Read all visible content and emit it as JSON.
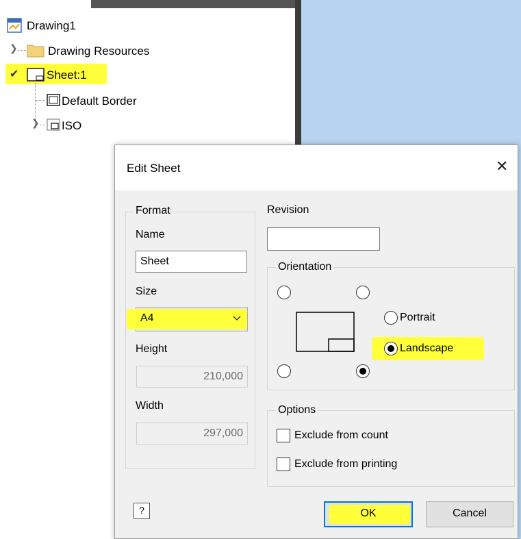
{
  "tree": {
    "root_label": "Drawing1",
    "resources_label": "Drawing Resources",
    "sheet_label": "Sheet:1",
    "border_label": "Default Border",
    "iso_label": "ISO"
  },
  "dialog": {
    "title": "Edit Sheet",
    "close_glyph": "✕",
    "format": {
      "caption": "Format",
      "name_label": "Name",
      "name_value": "Sheet",
      "size_label": "Size",
      "size_value": "A4",
      "height_label": "Height",
      "height_value": "210,000",
      "width_label": "Width",
      "width_value": "297,000"
    },
    "revision": {
      "label": "Revision",
      "value": ""
    },
    "orientation": {
      "caption": "Orientation",
      "portrait_label": "Portrait",
      "landscape_label": "Landscape",
      "selected": "Landscape",
      "title_block_corner": "bottom-right"
    },
    "options": {
      "caption": "Options",
      "exclude_count_label": "Exclude from count",
      "exclude_printing_label": "Exclude from printing"
    },
    "buttons": {
      "help_glyph": "?",
      "ok_label": "OK",
      "cancel_label": "Cancel"
    }
  },
  "colors": {
    "highlight": "#ffff3a",
    "accent": "#0078d7",
    "sheet_background": "#b8d4f0"
  }
}
